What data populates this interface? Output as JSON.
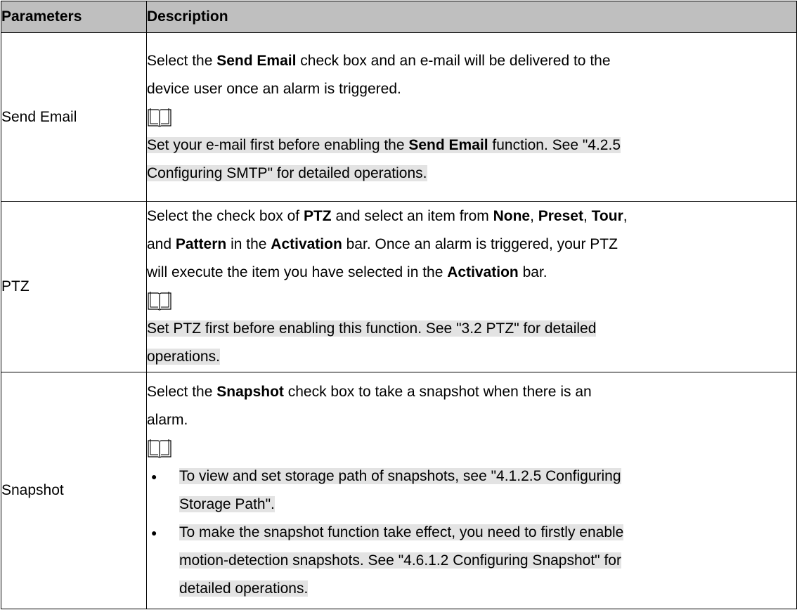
{
  "table": {
    "headers": [
      "Parameters",
      "Description"
    ],
    "rows": [
      {
        "param": "Send Email",
        "desc_line1_a": "Select the ",
        "desc_line1_b": "Send Email",
        "desc_line1_c": " check box and an e-mail will be delivered to the",
        "desc_line2": "device user once an alarm is triggered.",
        "note_line1_a": "Set your e-mail first before enabling the ",
        "note_line1_b": "Send Email",
        "note_line1_c": " function. See \"4.2.5",
        "note_line2": "Configuring SMTP\" for detailed operations."
      },
      {
        "param": "PTZ",
        "l1_a": "Select the check box of ",
        "l1_b": "PTZ",
        "l1_c": " and select an item from ",
        "l1_d": "None",
        "l1_e": ", ",
        "l1_f": "Preset",
        "l1_g": ", ",
        "l1_h": "Tour",
        "l1_i": ",",
        "l2_a": "and ",
        "l2_b": "Pattern",
        "l2_c": " in the ",
        "l2_d": "Activation",
        "l2_e": " bar. Once an alarm is triggered, your PTZ",
        "l3_a": "will execute the item you have selected in the ",
        "l3_b": "Activation",
        "l3_c": " bar.",
        "note_line1": "Set PTZ first before enabling this function. See \"3.2 PTZ\" for detailed",
        "note_line2": "operations."
      },
      {
        "param": "Snapshot",
        "l1_a": "Select the ",
        "l1_b": "Snapshot",
        "l1_c": " check box to take a snapshot when there is an",
        "l2": "alarm.",
        "bullet_mark": "●",
        "b1_line1": "To view and set storage path of snapshots, see \"4.1.2.5 Configuring",
        "b1_line2": "Storage Path\".",
        "b2_line1": "To make the snapshot function take effect, you need to firstly enable",
        "b2_line2": "motion-detection snapshots. See \"4.6.1.2 Configuring Snapshot\" for",
        "b2_line3": "detailed operations."
      }
    ]
  },
  "icons": {
    "note": "book-note-icon"
  }
}
